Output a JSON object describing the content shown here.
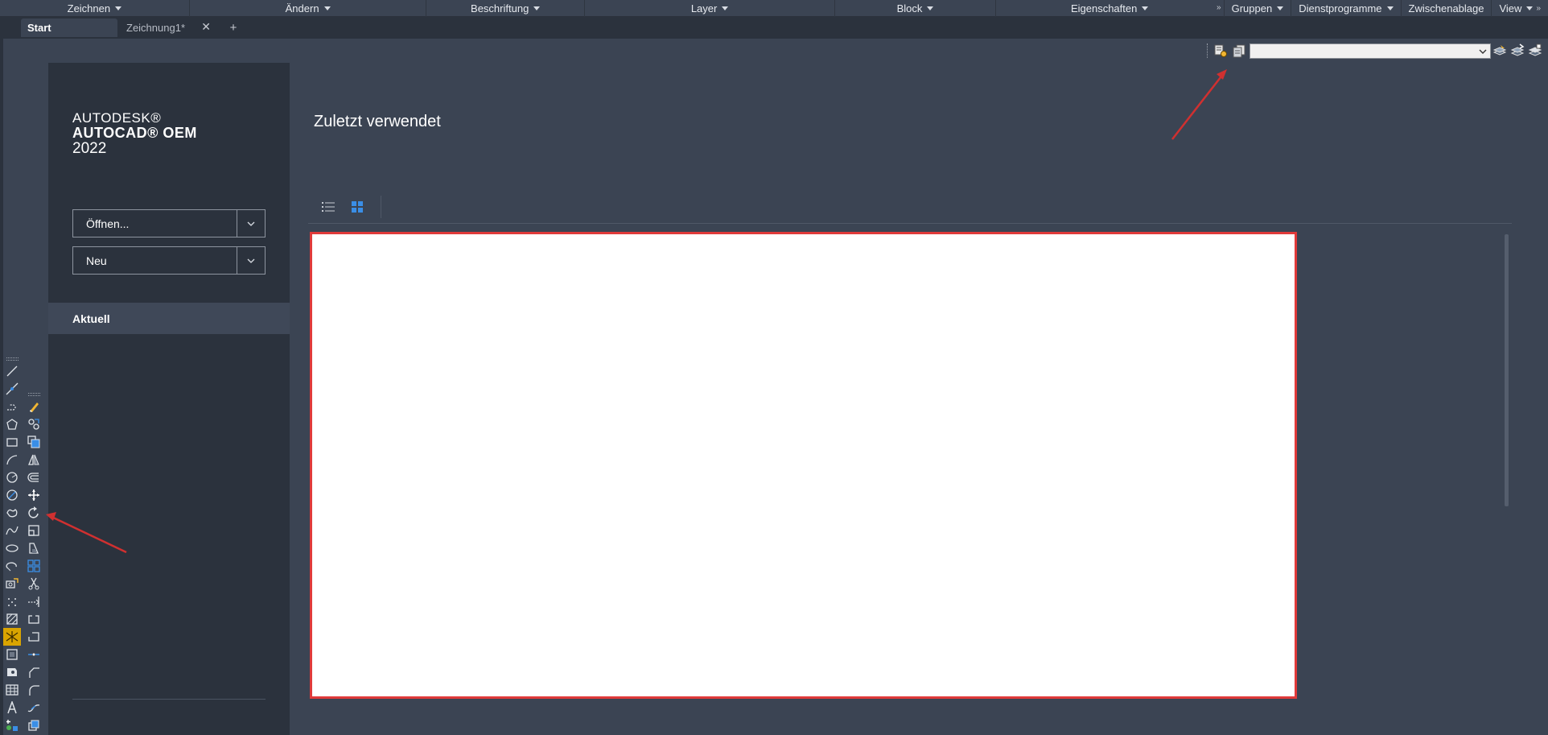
{
  "ribbon": {
    "panels": [
      {
        "label": "Zeichnen"
      },
      {
        "label": "Ändern"
      },
      {
        "label": "Beschriftung"
      },
      {
        "label": "Layer"
      },
      {
        "label": "Block"
      },
      {
        "label": "Eigenschaften"
      }
    ],
    "right_panels": [
      {
        "label": "Gruppen"
      },
      {
        "label": "Dienstprogramme"
      },
      {
        "label": "Zwischenablage"
      },
      {
        "label": "View"
      }
    ]
  },
  "tabs": {
    "start": "Start",
    "drawing": "Zeichnung1*",
    "close_glyph": "✕",
    "add_glyph": "+"
  },
  "layer_combo": {
    "value": ""
  },
  "sidebar": {
    "brand_line1": "AUTODESK®",
    "brand_line2": "AUTOCAD® OEM",
    "brand_line3": "2022",
    "open_button": "Öffnen...",
    "new_button": "Neu",
    "aktuell": "Aktuell"
  },
  "main": {
    "title": "Zuletzt verwendet"
  },
  "colors": {
    "accent": "#3a8ee6",
    "annotation": "#d03030",
    "highlight_border": "#e03a3a"
  },
  "draw_toolbar_icons": [
    "line-icon",
    "construction-line-icon",
    "polyline-icon",
    "polygon-icon",
    "rectangle-icon",
    "arc-icon",
    "circle-icon",
    "revision-cloud-icon",
    "spline-icon",
    "ellipse-icon",
    "ellipse-arc-icon",
    "insert-block-icon",
    "make-block-icon",
    "point-icon",
    "hatch-icon",
    "gradient-icon",
    "region-icon",
    "table-icon",
    "multiline-text-icon",
    "add-selected-icon"
  ],
  "modify_toolbar_icons": [
    "erase-icon",
    "copy-icon",
    "mirror-icon",
    "offset-icon",
    "array-icon",
    "move-icon",
    "rotate-icon",
    "scale-icon",
    "stretch-icon",
    "rectangular-array-icon",
    "trim-icon",
    "extend-icon",
    "break-at-point-icon",
    "break-icon",
    "join-icon",
    "chamfer-icon",
    "fillet-icon",
    "blend-curves-icon",
    "explode-icon"
  ]
}
